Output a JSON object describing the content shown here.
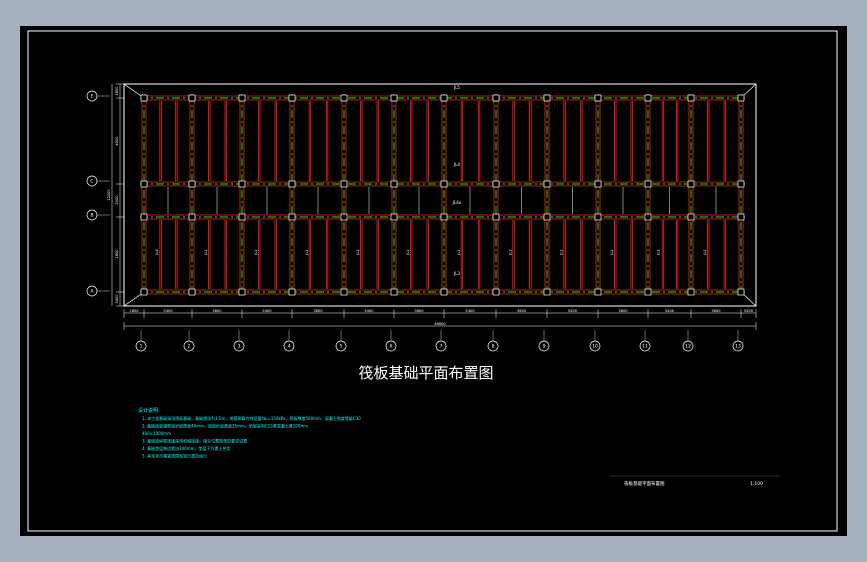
{
  "drawing": {
    "title": "筏板基础平面布置图",
    "title_block_name": "筏板基础平面布置图",
    "title_block_scale": "1:100",
    "beam_labels": [
      "JL5",
      "JL4",
      "JL4a",
      "JL3"
    ],
    "vertical_beam_labels": [
      "JL4",
      "JL1",
      "JL1",
      "JL1",
      "JL1",
      "JL1",
      "JL1",
      "JL1",
      "JL1",
      "JL1",
      "JL1",
      "JL1",
      "JL2",
      "JL2",
      "JL1"
    ],
    "row_axes": [
      "E",
      "C",
      "B",
      "A"
    ],
    "column_axes": [
      "1",
      "2",
      "3",
      "4",
      "5",
      "6",
      "7",
      "8",
      "9",
      "10",
      "11",
      "12",
      "13"
    ],
    "left_total_dim": "12000",
    "left_dims": [
      "1800",
      "4500",
      "2000",
      "1800",
      "3400",
      "1800"
    ],
    "bottom_dims": [
      "1800",
      "5400",
      "3600",
      "5400",
      "3600",
      "5400",
      "3600",
      "5400",
      "3600",
      "5400",
      "3600",
      "5400",
      "3600",
      "5400",
      "1800"
    ],
    "bottom_total_dim": "46800",
    "notes_title": "设计说明:",
    "notes": [
      "1. 本工程基础采用筏板基础，基础埋深为1.5m，地基承载力特征值fak=150kPa，筏板厚度500mm，混凝土强度等级C30",
      "2. 基础底板钢筋保护层厚度40mm，梁保护层厚度35mm，垫层采用C15素混凝土厚100mm",
      "   400×1000mm",
      "3. 基础梁纵筋连接采用机械连接，接头位置按规范要求设置",
      "4. 基础垫层每边宽出100mm，垫层下为素土夯实",
      "5. 其余未尽事宜按国家现行规范执行"
    ]
  }
}
